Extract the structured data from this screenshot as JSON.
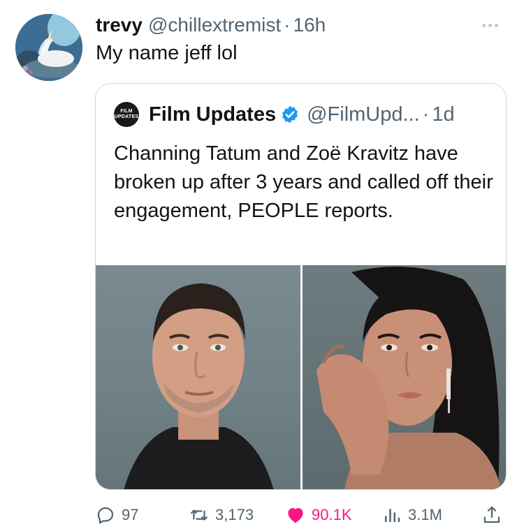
{
  "tweet": {
    "author": {
      "display_name": "trevy",
      "handle": "@chillextremist",
      "avatar_icon": "unicorn-avatar"
    },
    "separator": "·",
    "time": "16h",
    "more_icon": "more-options-icon",
    "text": "My name jeff lol"
  },
  "quote": {
    "logo_text_line1": "FILM",
    "logo_text_line2": "UPDATES",
    "display_name": "Film Updates",
    "verified_icon": "verified-badge-icon",
    "verified_color": "#1d9bf0",
    "handle": "@FilmUpd...",
    "separator": "·",
    "time": "1d",
    "text": "Channing Tatum and Zoë Kravitz have broken up after 3 years and called off their engagement, PEOPLE reports.",
    "photos": [
      "man-portrait-photo",
      "woman-portrait-photo"
    ]
  },
  "actions": {
    "reply_count": "97",
    "retweet_count": "3,173",
    "like_count": "90.1K",
    "views_count": "3.1M",
    "like_color": "#f91880",
    "muted_color": "#536471"
  }
}
